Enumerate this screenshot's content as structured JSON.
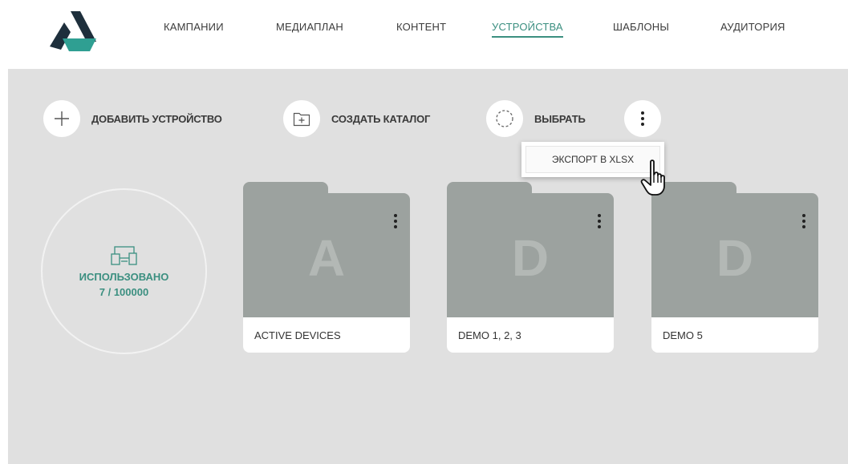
{
  "nav": {
    "items": [
      {
        "label": "КАМПАНИИ"
      },
      {
        "label": "МЕДИАПЛАН"
      },
      {
        "label": "КОНТЕНТ"
      },
      {
        "label": "УСТРОЙСТВА",
        "active": true
      },
      {
        "label": "ШАБЛОНЫ"
      },
      {
        "label": "АУДИТОРИЯ"
      }
    ]
  },
  "toolbar": {
    "add_device": {
      "label": "ДОБАВИТЬ УСТРОЙСТВО",
      "icon": "plus-icon"
    },
    "create_catalog": {
      "label": "СОЗДАТЬ КАТАЛОГ",
      "icon": "add-folder-icon"
    },
    "select": {
      "label": "ВЫБРАТЬ",
      "icon": "dashed-circle-icon"
    },
    "more": {
      "icon": "more-vertical-icon"
    }
  },
  "dropdown": {
    "export_label": "ЭКСПОРТ В XLSX"
  },
  "usage": {
    "label": "ИСПОЛЬЗОВАНО",
    "count": "7 / 100000",
    "icon": "devices-icon"
  },
  "folders": [
    {
      "letter": "A",
      "name": "ACTIVE DEVICES"
    },
    {
      "letter": "D",
      "name": "DEMO 1, 2, 3"
    },
    {
      "letter": "D",
      "name": "DEMO 5"
    }
  ],
  "colors": {
    "accent": "#3b8f80",
    "logo_dark": "#1e2f3c",
    "logo_teal": "#2f9f92",
    "folder": "#9ca29f",
    "background": "#e0e0e0"
  }
}
